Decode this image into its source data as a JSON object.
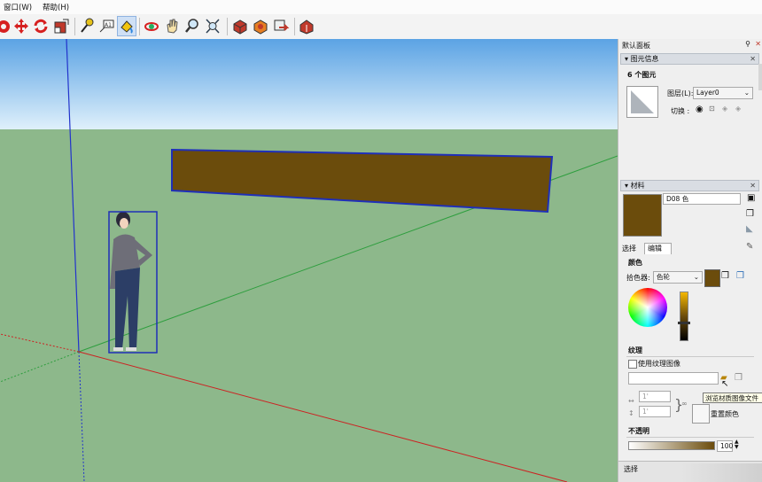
{
  "menu": [
    "窗口(W)",
    "帮助(H)"
  ],
  "toolbar": {
    "icons": [
      "rotate-view-icon",
      "move-icon",
      "rotate-icon",
      "scale-icon",
      "tape-measure-icon",
      "text-icon",
      "paint-bucket-icon",
      "orbit-icon",
      "pan-icon",
      "zoom-icon",
      "zoom-extents-icon",
      "get-models-icon",
      "share-model-icon",
      "component-icon",
      "warehouse-icon"
    ]
  },
  "colors": {
    "sky": "#5ba8e6",
    "ground": "#8db88b",
    "material": "#6b4c0c",
    "selection": "#1f2fb8"
  },
  "panel": {
    "tray_title": "默认面板",
    "entity_info": {
      "title": "图元信息",
      "count": "6 个图元",
      "layer_label": "图层(L):",
      "layer_value": "Layer0",
      "toggle_label": "切换 :"
    },
    "materials": {
      "title": "材料",
      "name_value": "D08 色",
      "tabs": [
        "选择",
        "编辑"
      ],
      "active_tab": "编辑",
      "color_heading": "颜色",
      "picker_label": "拾色器:",
      "picker_value": "色轮",
      "texture_heading": "纹理",
      "use_texture_label": "使用纹理图像",
      "use_texture_checked": false,
      "width_value": "1'",
      "height_value": "1'",
      "tooltip": "浏览材质图像文件",
      "reset_color": "重置颜色",
      "opacity_heading": "不透明",
      "opacity_value": "100"
    },
    "bottom_tab": "选择"
  }
}
